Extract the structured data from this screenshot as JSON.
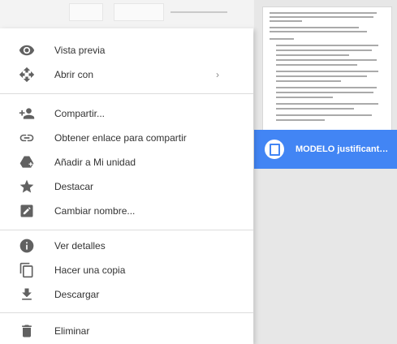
{
  "menu": {
    "items": [
      {
        "label": "Vista previa",
        "icon": "eye-icon"
      },
      {
        "label": "Abrir con",
        "icon": "open-with-icon",
        "submenu": "›"
      },
      {
        "label": "Compartir...",
        "icon": "person-add-icon"
      },
      {
        "label": "Obtener enlace para compartir",
        "icon": "link-icon"
      },
      {
        "label": "Añadir a Mi unidad",
        "icon": "add-to-drive-icon"
      },
      {
        "label": "Destacar",
        "icon": "star-icon"
      },
      {
        "label": "Cambiar nombre...",
        "icon": "edit-icon"
      },
      {
        "label": "Ver detalles",
        "icon": "info-icon"
      },
      {
        "label": "Hacer una copia",
        "icon": "copy-icon"
      },
      {
        "label": "Descargar",
        "icon": "download-icon"
      },
      {
        "label": "Eliminar",
        "icon": "trash-icon"
      }
    ]
  },
  "file": {
    "name": "MODELO justificante...",
    "icon": "google-docs-icon"
  },
  "colors": {
    "accent": "#4285f4",
    "icon": "#616161",
    "text": "#333333"
  }
}
